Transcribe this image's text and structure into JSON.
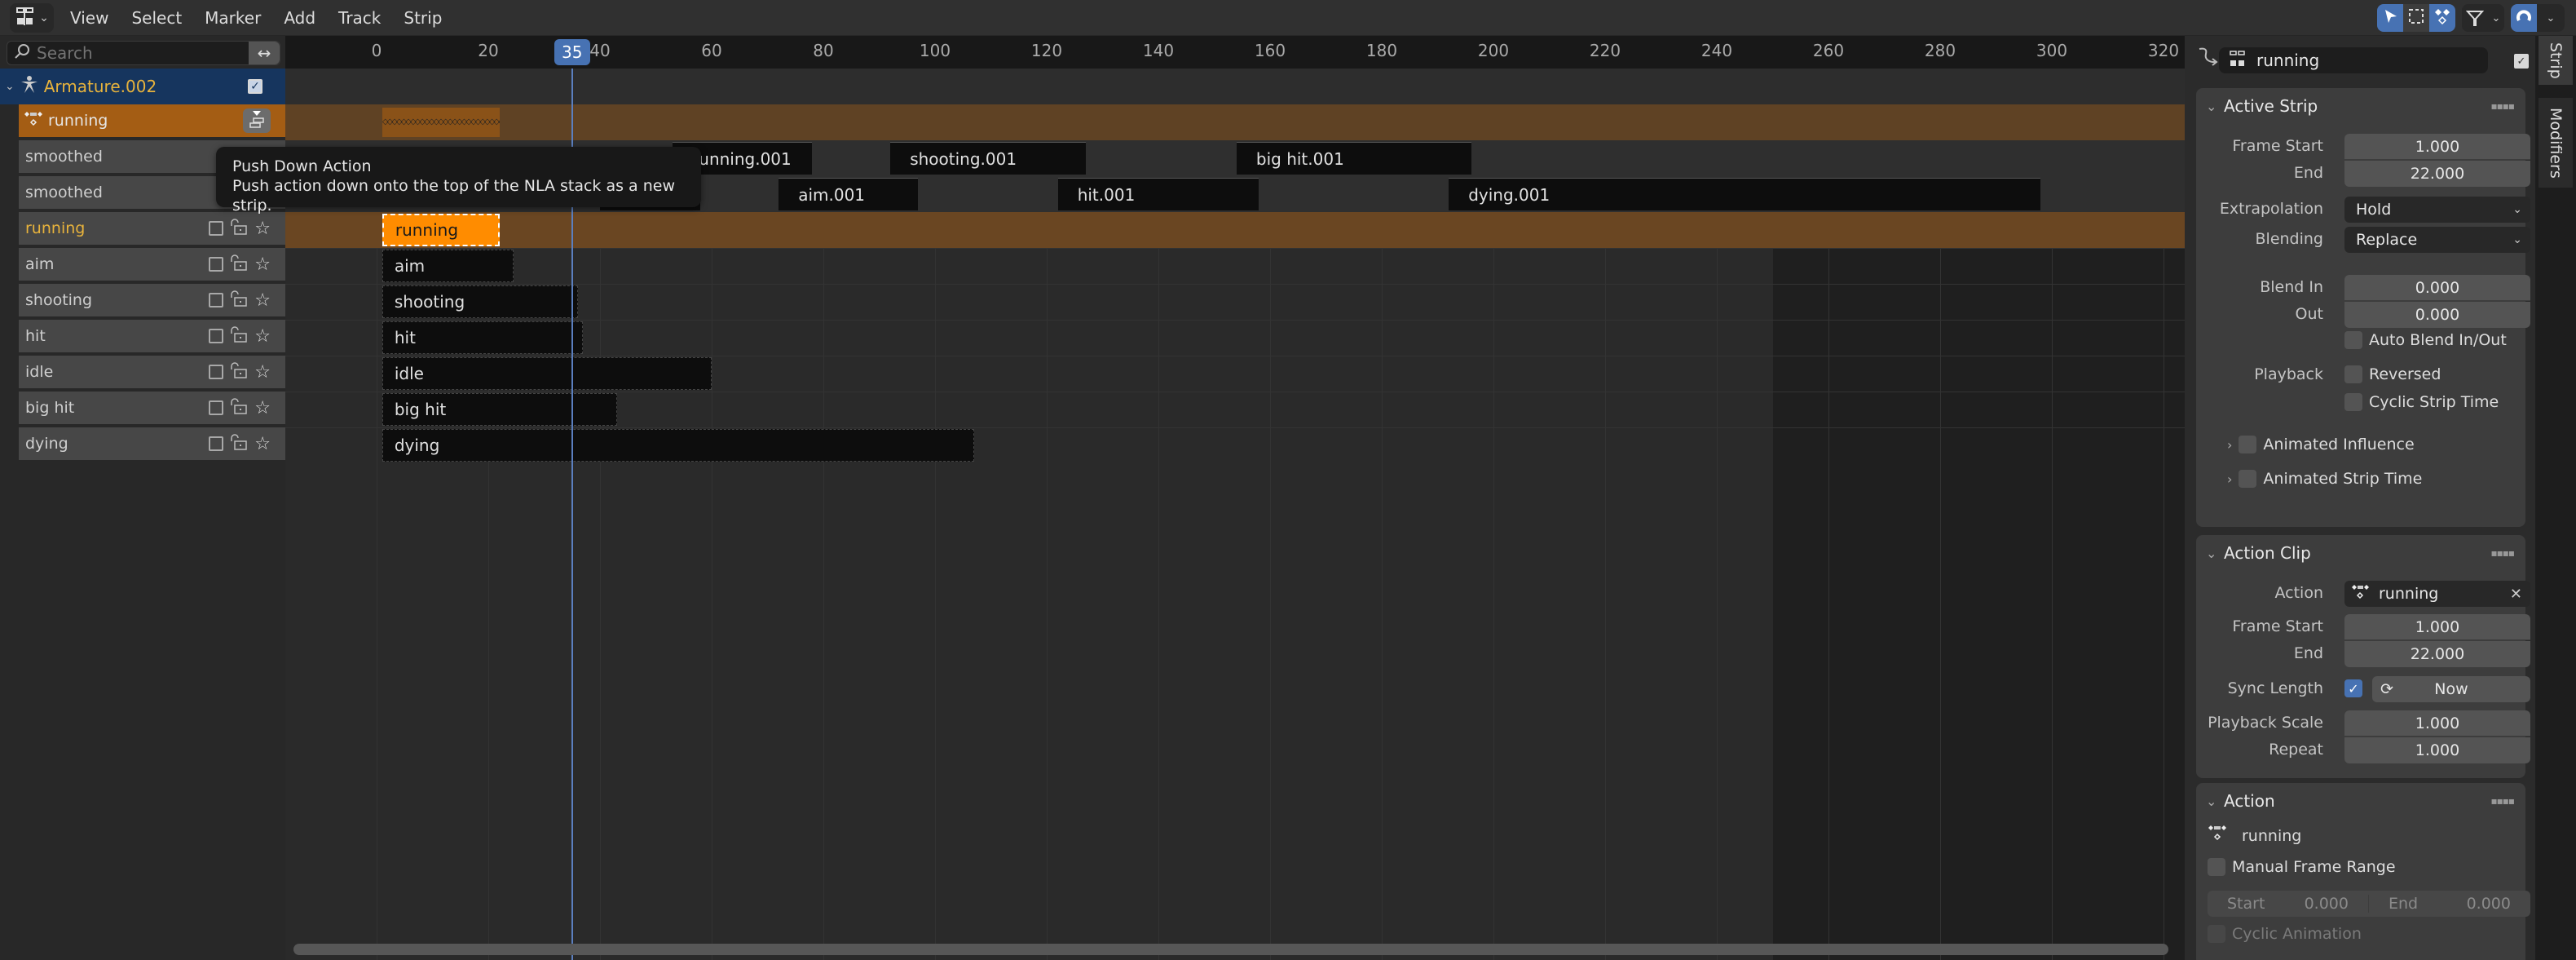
{
  "header": {
    "editor_type_icon": "nla-editor-icon",
    "menus": [
      "View",
      "Select",
      "Marker",
      "Add",
      "Track",
      "Strip"
    ],
    "right_tools": [
      "select-cursor-icon",
      "box-select-icon",
      "keyframe-icon",
      "filter-icon",
      "snap-magnet-icon"
    ]
  },
  "channels": {
    "search_placeholder": "Search",
    "object": {
      "name": "Armature.002",
      "checked": true
    },
    "action_line": {
      "name": "running"
    },
    "tracks": [
      {
        "name": "smoothed",
        "checked": true
      },
      {
        "name": "smoothed",
        "checked": true
      },
      {
        "name": "running",
        "active": true
      },
      {
        "name": "aim"
      },
      {
        "name": "shooting"
      },
      {
        "name": "hit"
      },
      {
        "name": "idle"
      },
      {
        "name": "big hit"
      },
      {
        "name": "dying"
      }
    ]
  },
  "timeline": {
    "ticks": [
      "0",
      "20",
      "40",
      "60",
      "80",
      "100",
      "120",
      "140",
      "160",
      "180",
      "200",
      "220",
      "240",
      "260",
      "280",
      "300",
      "320"
    ],
    "current_frame": "35",
    "current_frame_value": 35,
    "scene_end_frame": 250,
    "action_line_keys": {
      "start": 1,
      "end": 22
    },
    "transition_tracks": [
      {
        "row": 0,
        "strips": [
          {
            "label": "running.001",
            "start": 53,
            "end": 78
          },
          {
            "label": "shooting.001",
            "start": 92,
            "end": 127
          },
          {
            "label": "big hit.001",
            "start": 154,
            "end": 196
          }
        ]
      },
      {
        "row": 1,
        "strips": [
          {
            "label": "",
            "start": 40,
            "end": 58
          },
          {
            "label": "aim.001",
            "start": 72,
            "end": 97
          },
          {
            "label": "hit.001",
            "start": 122,
            "end": 158
          },
          {
            "label": "dying.001",
            "start": 192,
            "end": 298
          }
        ]
      }
    ],
    "strips": [
      {
        "label": "running",
        "start": 1,
        "end": 22,
        "selected": true
      },
      {
        "label": "aim",
        "start": 1,
        "end": 24.5
      },
      {
        "label": "shooting",
        "start": 1,
        "end": 36
      },
      {
        "label": "hit",
        "start": 1,
        "end": 37
      },
      {
        "label": "idle",
        "start": 1,
        "end": 60
      },
      {
        "label": "big hit",
        "start": 1,
        "end": 43
      },
      {
        "label": "dying",
        "start": 1,
        "end": 107
      }
    ]
  },
  "tooltip": {
    "title": "Push Down Action",
    "description": "Push action down onto the top of the NLA stack as a new strip."
  },
  "sidebar": {
    "strip_name": "running",
    "strip_enabled": true,
    "tabs": [
      "Strip",
      "Modifiers"
    ],
    "active_strip": {
      "title": "Active Strip",
      "frame_start_label": "Frame Start",
      "frame_start": "1.000",
      "end_label": "End",
      "end": "22.000",
      "extrapolation_label": "Extrapolation",
      "extrapolation": "Hold",
      "blending_label": "Blending",
      "blending": "Replace",
      "blend_in_label": "Blend In",
      "blend_in": "0.000",
      "out_label": "Out",
      "out": "0.000",
      "auto_blend_label": "Auto Blend In/Out",
      "playback_label": "Playback",
      "reversed_label": "Reversed",
      "cyclic_label": "Cyclic Strip Time",
      "animated_influence_label": "Animated Influence",
      "animated_strip_time_label": "Animated Strip Time"
    },
    "action_clip": {
      "title": "Action Clip",
      "action_label": "Action",
      "action": "running",
      "frame_start_label": "Frame Start",
      "frame_start": "1.000",
      "end_label": "End",
      "end": "22.000",
      "sync_length_label": "Sync Length",
      "sync_length_checked": true,
      "now_label": "Now",
      "playback_scale_label": "Playback Scale",
      "playback_scale": "1.000",
      "repeat_label": "Repeat",
      "repeat": "1.000"
    },
    "action": {
      "title": "Action",
      "name": "running",
      "manual_frame_range_label": "Manual Frame Range",
      "start_label": "Start",
      "start": "0.000",
      "end_label": "End",
      "end": "0.000",
      "cyclic_animation_label": "Cyclic Animation"
    }
  }
}
